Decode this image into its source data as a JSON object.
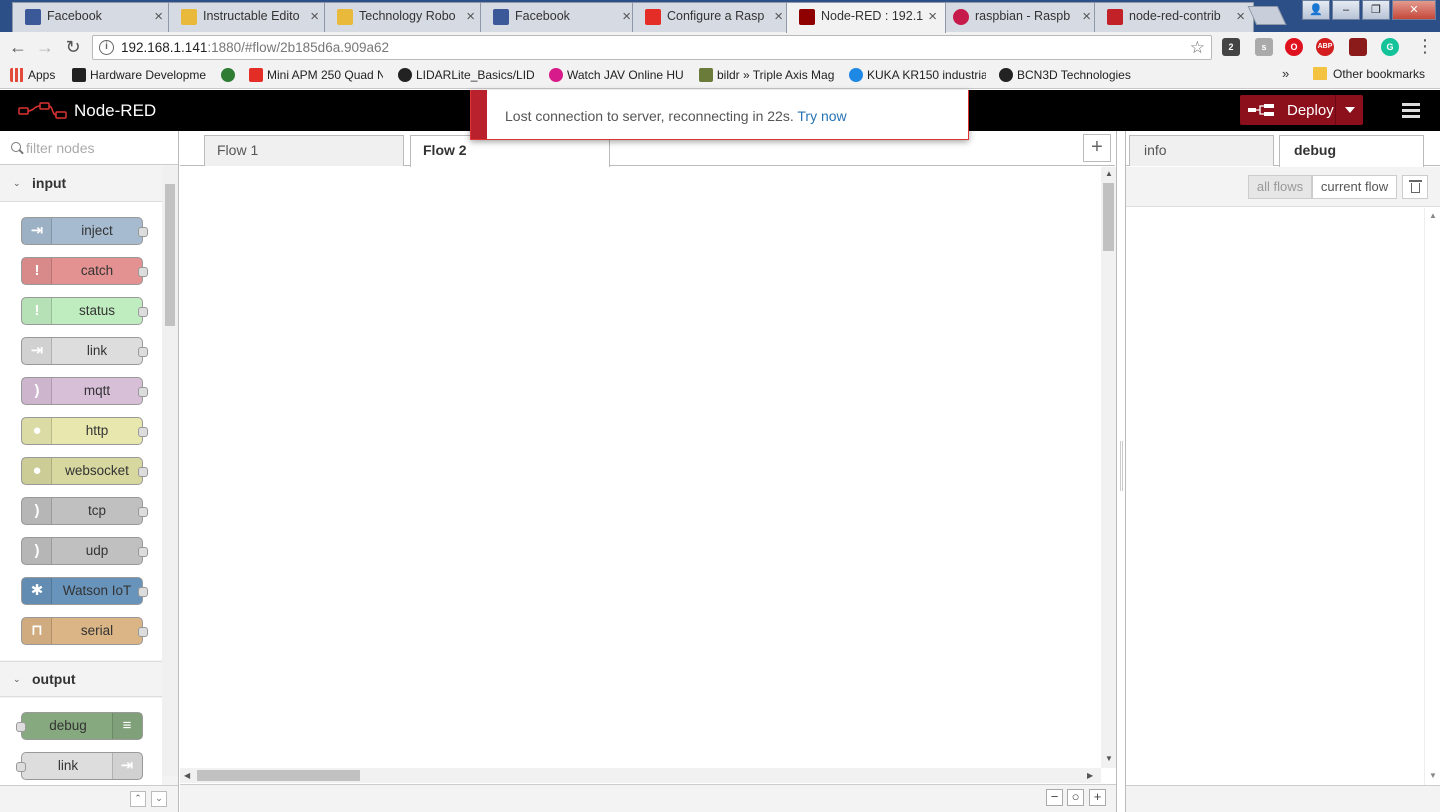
{
  "browser": {
    "tabs": [
      {
        "title": "Facebook",
        "favicon_color": "#3b5998",
        "letter": "f"
      },
      {
        "title": "Instructable Edito",
        "favicon_color": "#e8b93b",
        "letter": ""
      },
      {
        "title": "Technology Robo",
        "favicon_color": "#e8b93b",
        "letter": ""
      },
      {
        "title": "Facebook",
        "favicon_color": "#3b5998",
        "letter": "f"
      },
      {
        "title": "Configure a Rasp",
        "favicon_color": "#e52d27",
        "letter": "▶"
      },
      {
        "title": "Node-RED : 192.1",
        "favicon_color": "#8f0000",
        "letter": ""
      },
      {
        "title": "raspbian - Raspb",
        "favicon_color": "#c51a4a",
        "letter": ""
      },
      {
        "title": "node-red-contrib",
        "favicon_color": "#c12127",
        "letter": "n"
      }
    ],
    "close_glyph": "×",
    "window_controls": {
      "user": "👤",
      "minimize": "–",
      "maximize": "❐",
      "close": "✕"
    },
    "nav": {
      "back": "←",
      "forward": "→",
      "reload": "↻"
    },
    "url_host": "192.168.1.141",
    "url_rest": ":1880/#flow/2b185d6a.909a62",
    "info_glyph": "i",
    "star_glyph": "☆",
    "extensions": [
      {
        "label": "2",
        "color": "#444"
      },
      {
        "label": "s",
        "color": "#aaa"
      },
      {
        "label": "O",
        "color": "#e0111e"
      },
      {
        "label": "ABP",
        "color": "#d21e1e"
      },
      {
        "label": "",
        "color": "#8b1a1a"
      },
      {
        "label": "G",
        "color": "#15c39a"
      }
    ],
    "menu_glyph": "⋮",
    "bookmarks": [
      {
        "label": "Apps",
        "color": "#e34a3a"
      },
      {
        "label": "Hardware Developme",
        "color": "#222"
      },
      {
        "label": "",
        "color": "#2e7d32"
      },
      {
        "label": "Mini APM 250 Quad N",
        "color": "#e52d27"
      },
      {
        "label": "LIDARLite_Basics/LIDA",
        "color": "#222"
      },
      {
        "label": "Watch JAV Online HU",
        "color": "#d81b8a"
      },
      {
        "label": "bildr » Triple Axis Mag",
        "color": "#6a7b3a"
      },
      {
        "label": "KUKA KR150 industria",
        "color": "#1e88e5"
      },
      {
        "label": "BCN3D Technologies",
        "color": "#222"
      }
    ],
    "bookmarks_more": "»",
    "other_bookmarks": "Other bookmarks"
  },
  "app": {
    "title": "Node-RED",
    "deploy_label": "Deploy",
    "accent": "#8c101c"
  },
  "notification": {
    "message": "Lost connection to server, reconnecting in 22s.",
    "action": "Try now"
  },
  "palette": {
    "filter_placeholder": "filter nodes",
    "categories": [
      {
        "label": "input",
        "nodes": [
          {
            "label": "inject",
            "color": "#a6bbcf",
            "glyph": "⇥"
          },
          {
            "label": "catch",
            "color": "#e49191",
            "glyph": "!"
          },
          {
            "label": "status",
            "color": "#c0edc0",
            "glyph": "!"
          },
          {
            "label": "link",
            "color": "#dddddd",
            "glyph": "⇥"
          },
          {
            "label": "mqtt",
            "color": "#d8bfd8",
            "glyph": ")"
          },
          {
            "label": "http",
            "color": "#e7e7ae",
            "glyph": "●"
          },
          {
            "label": "websocket",
            "color": "#d7d7a0",
            "glyph": "●"
          },
          {
            "label": "tcp",
            "color": "#c0c0c0",
            "glyph": ")"
          },
          {
            "label": "udp",
            "color": "#c0c0c0",
            "glyph": ")"
          },
          {
            "label": "Watson IoT",
            "color": "#6894bc",
            "glyph": "✱"
          },
          {
            "label": "serial",
            "color": "#dbb586",
            "glyph": "⊓"
          }
        ]
      },
      {
        "label": "output",
        "nodes": [
          {
            "label": "debug",
            "color": "#87a980",
            "glyph": "≡"
          },
          {
            "label": "link",
            "color": "#dddddd",
            "glyph": "⇥"
          }
        ]
      }
    ],
    "collapse_glyph": "⌄",
    "footer_up": "⌃",
    "footer_down": "⌄"
  },
  "workspace": {
    "tabs": [
      {
        "label": "Flow 1",
        "active": false
      },
      {
        "label": "Flow 2",
        "active": true
      }
    ],
    "add_glyph": "+",
    "zoom_out": "−",
    "zoom_reset": "○",
    "zoom_in": "+"
  },
  "sidebar": {
    "tabs": [
      {
        "label": "info",
        "active": false
      },
      {
        "label": "debug",
        "active": true
      }
    ],
    "filter_all": "all flows",
    "filter_current": "current flow"
  }
}
